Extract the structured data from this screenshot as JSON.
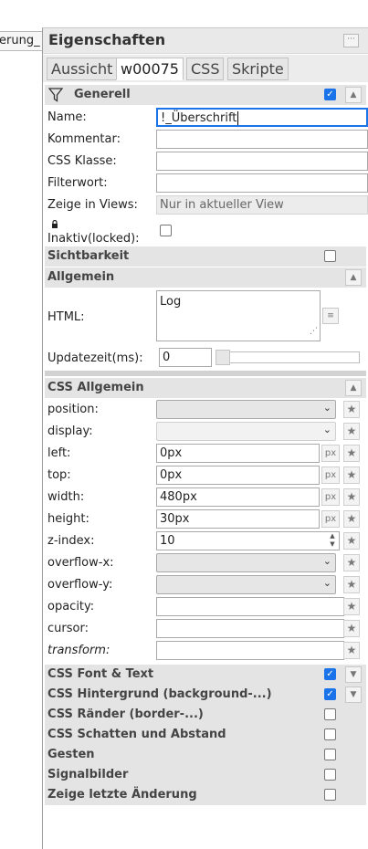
{
  "left_tab": {
    "label": "erung_"
  },
  "panel": {
    "title": "Eigenschaften",
    "collapse_icon": "ellipsis-icon"
  },
  "tabs": [
    {
      "label": "Aussicht",
      "active": false
    },
    {
      "label": "w00075",
      "active": true
    },
    {
      "label": "CSS",
      "active": false
    },
    {
      "label": "Skripte",
      "active": false
    }
  ],
  "generell": {
    "title": "Generell",
    "icon": "filter-icon",
    "checked": true,
    "fields": {
      "name_label": "Name:",
      "name_value": "!_Überschrift",
      "kommentar_label": "Kommentar:",
      "kommentar_value": "",
      "css_klasse_label": "CSS Klasse:",
      "css_klasse_value": "",
      "filterwort_label": "Filterwort:",
      "filterwort_value": "",
      "views_label": "Zeige in Views:",
      "views_value": "Nur in aktueller View",
      "inaktiv_label": "Inaktiv(locked):",
      "inaktiv_icon": "lock-icon"
    }
  },
  "sichtbarkeit": {
    "title": "Sichtbarkeit"
  },
  "allgemein": {
    "title": "Allgemein",
    "html_label": "HTML:",
    "html_value": "Log",
    "update_label": "Updatezeit(ms):",
    "update_value": "0"
  },
  "css_allgemein": {
    "title": "CSS Allgemein",
    "rows": [
      {
        "label": "position:",
        "type": "select",
        "value": ""
      },
      {
        "label": "display:",
        "type": "select",
        "value": ""
      },
      {
        "label": "left:",
        "type": "px",
        "value": "0px",
        "unit": "px"
      },
      {
        "label": "top:",
        "type": "px",
        "value": "0px",
        "unit": "px"
      },
      {
        "label": "width:",
        "type": "px",
        "value": "480px",
        "unit": "px"
      },
      {
        "label": "height:",
        "type": "px",
        "value": "30px",
        "unit": "px"
      },
      {
        "label": "z-index:",
        "type": "number",
        "value": "10"
      },
      {
        "label": "overflow-x:",
        "type": "select",
        "value": ""
      },
      {
        "label": "overflow-y:",
        "type": "select",
        "value": ""
      },
      {
        "label": "opacity:",
        "type": "text",
        "value": ""
      },
      {
        "label": "cursor:",
        "type": "text",
        "value": ""
      },
      {
        "label": "transform:",
        "type": "text",
        "value": ""
      }
    ]
  },
  "groups": [
    {
      "title": "CSS Font & Text",
      "checked": true,
      "arrow": true
    },
    {
      "title": "CSS Hintergrund (background-...)",
      "checked": true,
      "arrow": true
    },
    {
      "title": "CSS Ränder (border-...)",
      "checked": false,
      "arrow": false
    },
    {
      "title": "CSS Schatten und Abstand",
      "checked": false,
      "arrow": false
    },
    {
      "title": "Gesten",
      "checked": false,
      "arrow": false
    },
    {
      "title": "Signalbilder",
      "checked": false,
      "arrow": false
    },
    {
      "title": "Zeige letzte Änderung",
      "checked": false,
      "arrow": false
    }
  ]
}
